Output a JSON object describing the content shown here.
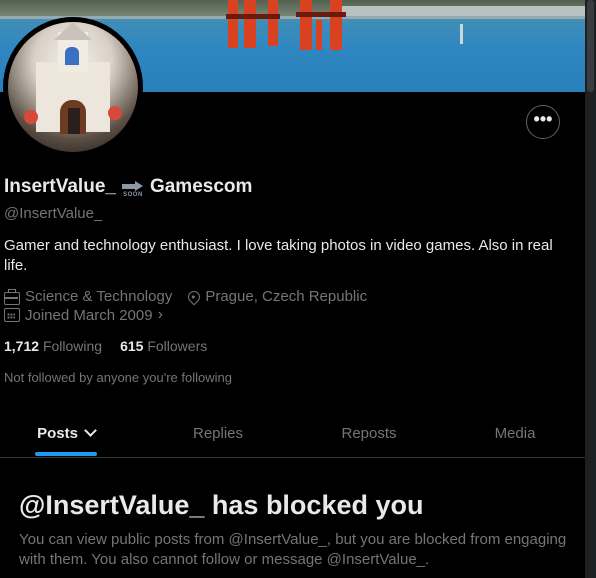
{
  "profile": {
    "display_name": "InsertValue_",
    "badge_text": "SOON",
    "name_suffix": "Gamescom",
    "handle": "@InsertValue_",
    "bio": "Gamer and technology enthusiast. I love taking photos in video games. Also in real life.",
    "category": "Science & Technology",
    "location": "Prague, Czech Republic",
    "joined": "Joined March 2009",
    "following_count": "1,712",
    "following_label": "Following",
    "followers_count": "615",
    "followers_label": "Followers",
    "not_followed_note": "Not followed by anyone you're following"
  },
  "actions": {
    "more_label": "•••"
  },
  "tabs": [
    {
      "label": "Posts",
      "active": true
    },
    {
      "label": "Replies",
      "active": false
    },
    {
      "label": "Reposts",
      "active": false
    },
    {
      "label": "Media",
      "active": false
    }
  ],
  "blocked": {
    "title": "@InsertValue_ has blocked you",
    "message": "You can view public posts from @InsertValue_, but you are blocked from engaging with them. You also cannot follow or message @InsertValue_."
  },
  "icons": {
    "category": "briefcase-icon",
    "location": "location-pin-icon",
    "joined": "calendar-icon",
    "more": "more-dots-icon",
    "tab_dropdown": "chevron-down-icon"
  },
  "colors": {
    "background": "#000000",
    "text_primary": "#e7e9ea",
    "text_secondary": "#71767b",
    "accent": "#1d9bf0",
    "border": "#2f3336"
  }
}
